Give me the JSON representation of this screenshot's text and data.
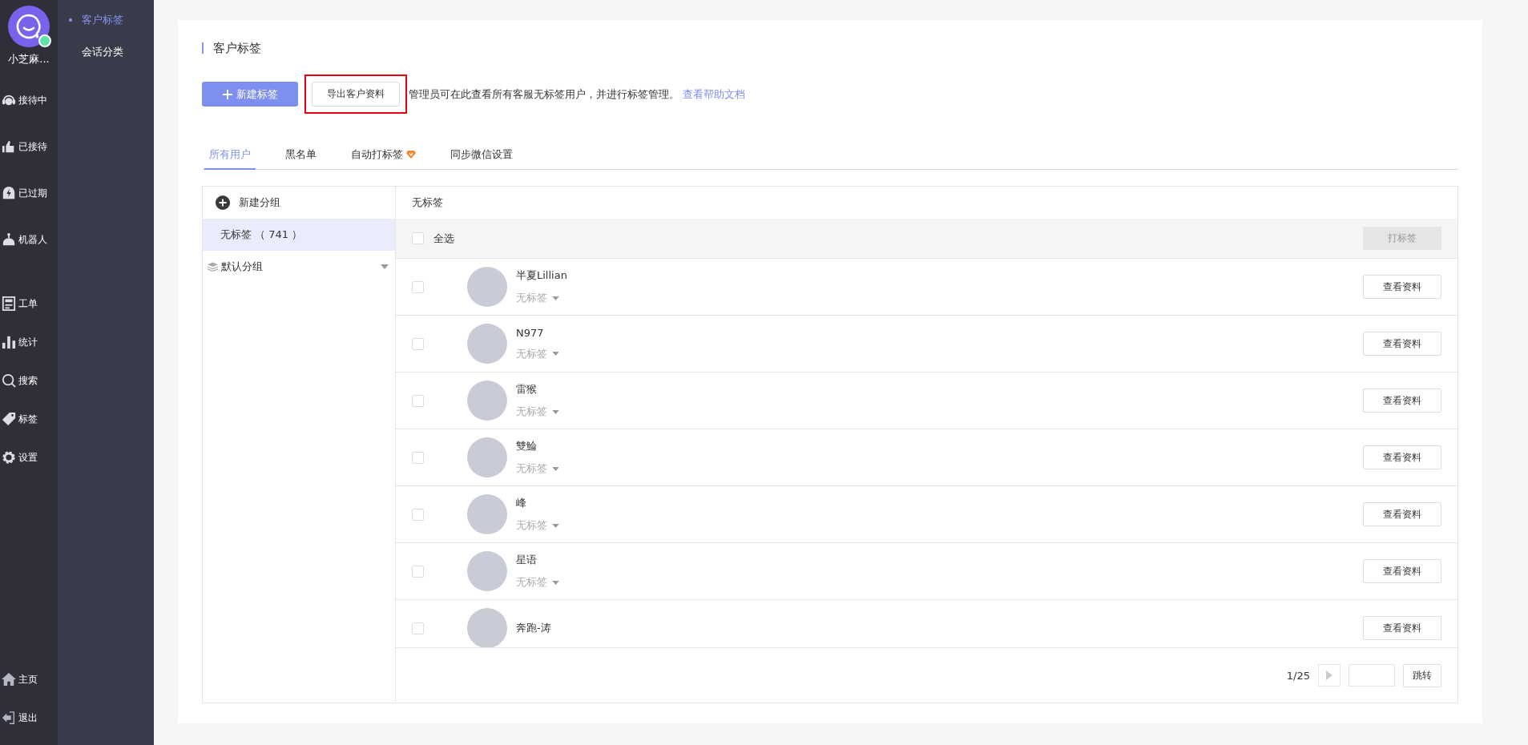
{
  "app": {
    "agent_name": "小芝麻...",
    "online": true
  },
  "nav": {
    "top": [
      {
        "label": "接待中"
      },
      {
        "label": "已接待"
      },
      {
        "label": "已过期"
      },
      {
        "label": "机器人"
      }
    ],
    "middle": [
      {
        "label": "工单"
      },
      {
        "label": "统计"
      },
      {
        "label": "搜索"
      },
      {
        "label": "标签"
      },
      {
        "label": "设置"
      }
    ],
    "bottom": [
      {
        "label": "主页"
      },
      {
        "label": "退出"
      }
    ]
  },
  "subnav": [
    {
      "label": "客户标签",
      "selected": true
    },
    {
      "label": "会话分类",
      "selected": false
    }
  ],
  "page_title": "客户标签",
  "toolbar": {
    "new_tag_button": "新建标签",
    "export_button": {
      "label": "导出客户资料",
      "highlighted": true
    },
    "hint": "管理员可在此查看所有客服无标签用户，并进行标签管理。",
    "help_link": "查看帮助文档"
  },
  "tabs": [
    {
      "label": "所有用户",
      "selected": true,
      "badge": false
    },
    {
      "label": "黑名单",
      "selected": false,
      "badge": false
    },
    {
      "label": "自动打标签",
      "selected": false,
      "badge": true
    },
    {
      "label": "同步微信设置",
      "selected": false,
      "badge": false
    }
  ],
  "groups": {
    "new_group": "新建分组",
    "items": [
      {
        "label": "无标签 （ 741 ）",
        "selected": true
      }
    ],
    "folder": {
      "label": "默认分组",
      "expanded": false
    }
  },
  "list": {
    "title": "无标签",
    "select_all": {
      "label": "全选",
      "checked": false
    },
    "tag_button": {
      "label": "打标签",
      "disabled": true
    },
    "rows": [
      {
        "name": "半夏Lillian",
        "tag": "无标签",
        "checked": false,
        "action": "查看资料"
      },
      {
        "name": "N977",
        "tag": "无标签",
        "checked": false,
        "action": "查看资料"
      },
      {
        "name": "雷猴",
        "tag": "无标签",
        "checked": false,
        "action": "查看资料"
      },
      {
        "name": "雙鯩",
        "tag": "无标签",
        "checked": false,
        "action": "查看资料"
      },
      {
        "name": "峰",
        "tag": "无标签",
        "checked": false,
        "action": "查看资料"
      },
      {
        "name": "星语",
        "tag": "无标签",
        "checked": false,
        "action": "查看资料"
      },
      {
        "name": "奔跑-涛",
        "checked": false,
        "action": "查看资料"
      }
    ]
  },
  "pagination": {
    "page": "1/25",
    "jump_button": "跳转"
  }
}
